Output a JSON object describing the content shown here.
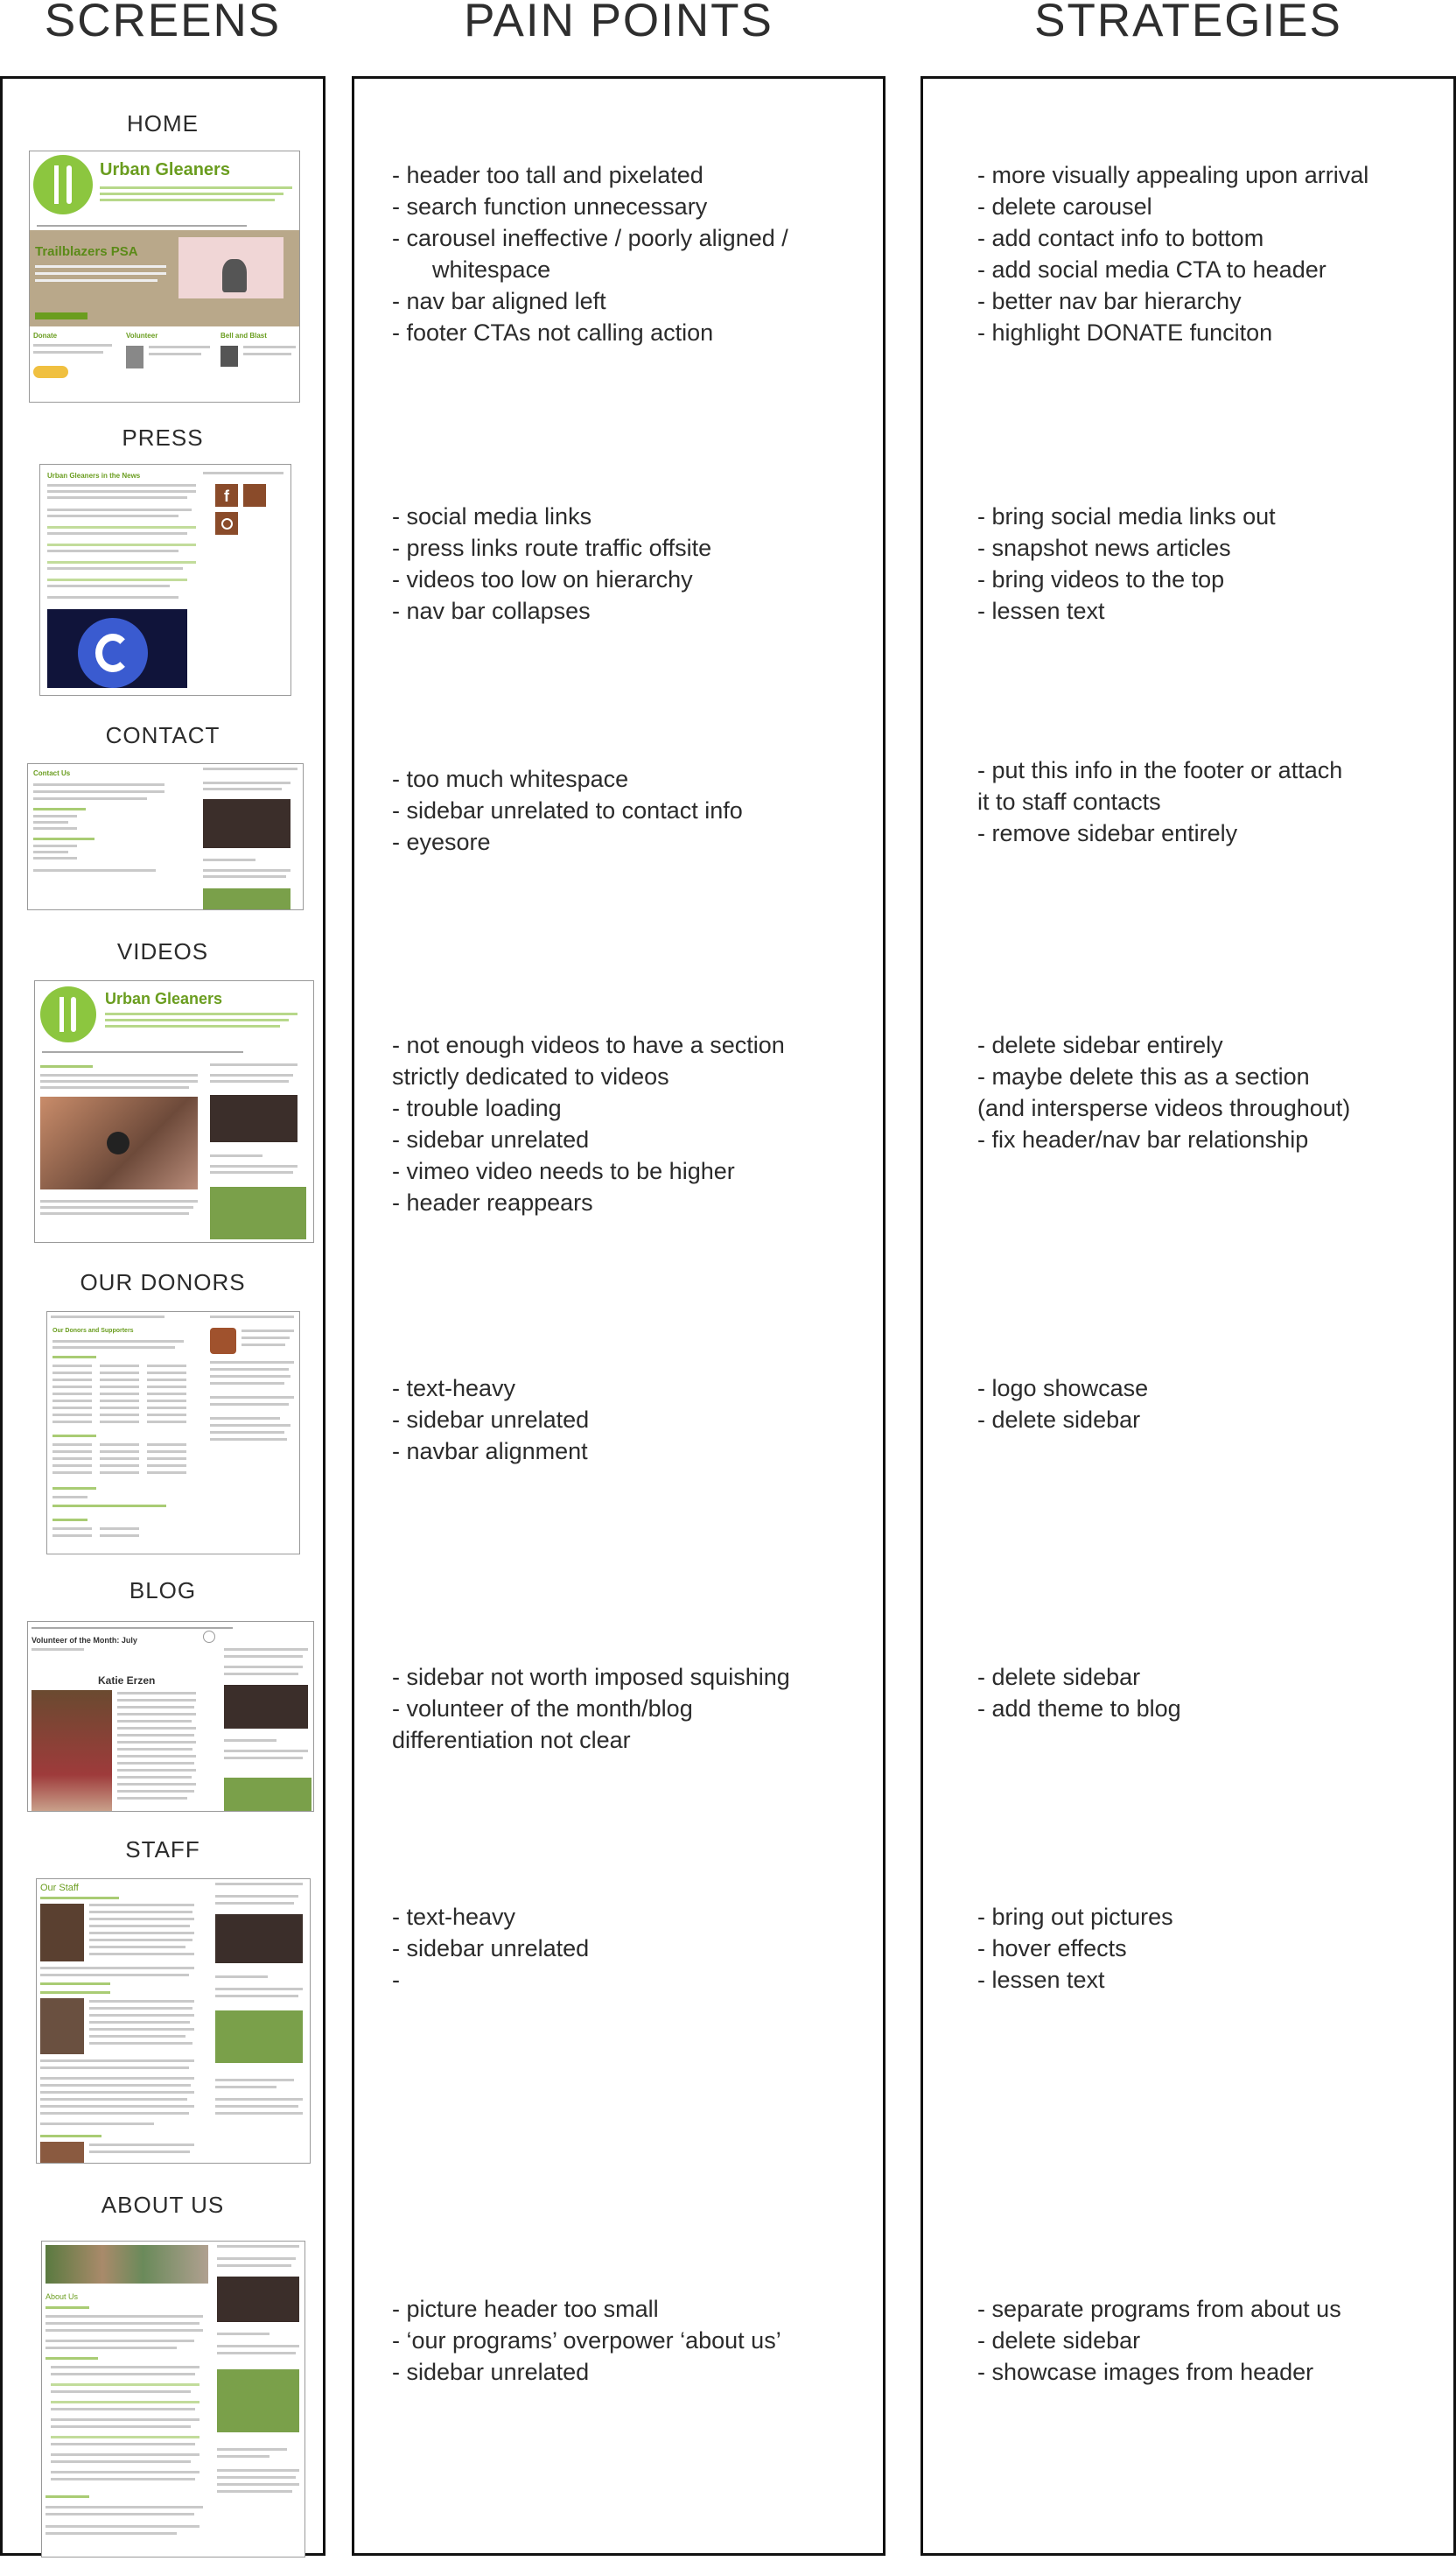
{
  "headers": {
    "screens": "SCREENS",
    "pain_points": "PAIN POINTS",
    "strategies": "STRATEGIES"
  },
  "sections": [
    {
      "label": "HOME",
      "pain": [
        "- header too tall and pixelated",
        "- search function unnecessary",
        "- carousel ineffective / poorly aligned /",
        "whitespace",
        "- nav bar aligned left",
        "- footer CTAs not calling action"
      ],
      "strategies": [
        "- more visually appealing upon arrival",
        "- delete carousel",
        "- add contact info to bottom",
        "- add social media CTA to header",
        "- better nav bar hierarchy",
        "- highlight DONATE funciton"
      ]
    },
    {
      "label": "PRESS",
      "pain": [
        "- social media links",
        "- press links route traffic offsite",
        "- videos too low on hierarchy",
        "- nav bar collapses"
      ],
      "strategies": [
        "- bring social media links out",
        "- snapshot news articles",
        "- bring videos to the top",
        "- lessen text"
      ]
    },
    {
      "label": "CONTACT",
      "pain": [
        "-  too much whitespace",
        "- sidebar unrelated to contact info",
        "- eyesore"
      ],
      "strategies": [
        "- put this info in the footer or attach",
        "it to staff contacts",
        "- remove sidebar entirely"
      ]
    },
    {
      "label": "VIDEOS",
      "pain": [
        "- not enough videos to have a section",
        "strictly dedicated to videos",
        "- trouble loading",
        "- sidebar unrelated",
        "- vimeo video needs to be higher",
        "- header reappears"
      ],
      "strategies": [
        "- delete sidebar entirely",
        "- maybe delete this as a section",
        "(and intersperse videos throughout)",
        "- fix header/nav bar relationship"
      ]
    },
    {
      "label": "OUR DONORS",
      "pain": [
        "- text-heavy",
        "- sidebar unrelated",
        "- navbar alignment"
      ],
      "strategies": [
        "- logo showcase",
        "- delete sidebar"
      ]
    },
    {
      "label": "BLOG",
      "pain": [
        "- sidebar not worth imposed squishing",
        "- volunteer of the month/blog",
        "differentiation not clear"
      ],
      "strategies": [
        "- delete sidebar",
        "- add theme to blog"
      ]
    },
    {
      "label": "STAFF",
      "pain": [
        "- text-heavy",
        "- sidebar unrelated",
        "-"
      ],
      "strategies": [
        "- bring out pictures",
        "- hover effects",
        "- lessen text"
      ]
    },
    {
      "label": "ABOUT US",
      "pain": [
        "- picture header too small",
        "- ‘our programs’ overpower ‘about us’",
        "- sidebar unrelated"
      ],
      "strategies": [
        "- separate programs from about us",
        "- delete sidebar",
        "- showcase images from header"
      ]
    }
  ],
  "thumb_text": {
    "brand": "Urban Gleaners",
    "home_feature": "Trailblazers PSA",
    "press_title": "Urban Gleaners in the News",
    "contact_title": "Contact Us",
    "donors_title": "Our Donors and Supporters",
    "blog_title": "Volunteer of the Month: July",
    "blog_name": "Katie Erzen",
    "staff_title": "Our Staff",
    "about_title": "About Us"
  },
  "colors": {
    "accent_green": "#6a9d1f",
    "logo_green": "#8cc63f",
    "carousel_tan": "#b9a88a"
  }
}
